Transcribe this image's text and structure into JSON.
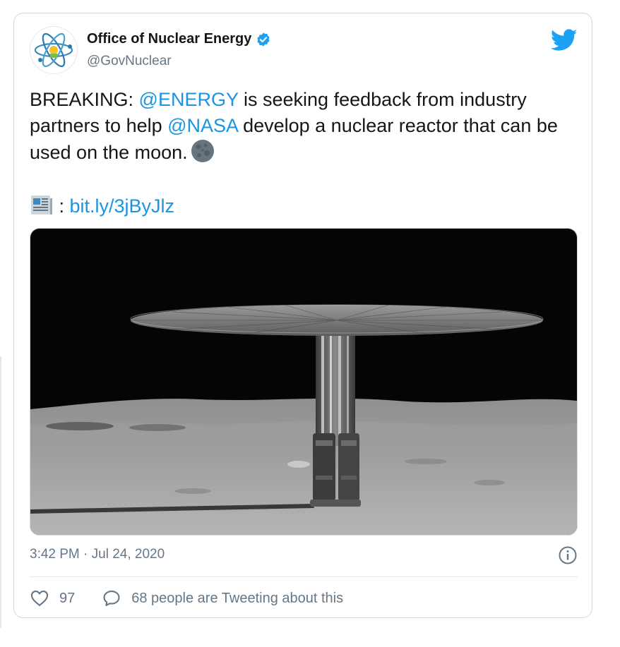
{
  "tweet": {
    "author_name": "Office of Nuclear Energy",
    "author_handle": "@GovNuclear",
    "text_parts": {
      "prefix": "BREAKING: ",
      "mention1": "@ENERGY",
      "middle": " is seeking feedback from industry partners to help ",
      "mention2": "@NASA",
      "suffix": " develop a nuclear reactor that can be used on the moon."
    },
    "link_separator": " : ",
    "link": "bit.ly/3jByJlz",
    "timestamp": "3:42 PM · Jul 24, 2020",
    "likes": "97",
    "replies_label": "68 people are Tweeting about this"
  },
  "colors": {
    "accent": "#1b95e0",
    "secondary_text": "#657786",
    "primary_text": "#14171a"
  },
  "icons": {
    "avatar": "atom-logo-icon",
    "verified": "verified-badge-icon",
    "brand": "twitter-bird-icon",
    "moon": "full-moon-emoji-icon",
    "newspaper": "newspaper-emoji-icon",
    "info": "info-icon",
    "like": "heart-icon",
    "reply": "speech-bubble-icon"
  }
}
